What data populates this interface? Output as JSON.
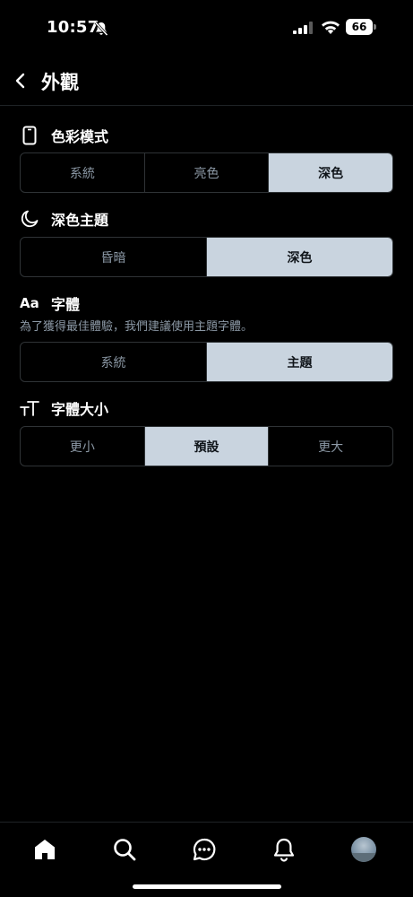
{
  "status_bar": {
    "time": "10:57",
    "battery": "66"
  },
  "header": {
    "title": "外觀"
  },
  "color_mode": {
    "title": "色彩模式",
    "options": [
      "系統",
      "亮色",
      "深色"
    ],
    "selected": "深色"
  },
  "dark_theme": {
    "title": "深色主題",
    "options": [
      "昏暗",
      "深色"
    ],
    "selected": "深色"
  },
  "font": {
    "icon_text": "Aa",
    "title": "字體",
    "description": "為了獲得最佳體驗，我們建議使用主題字體。",
    "options": [
      "系統",
      "主題"
    ],
    "selected": "主題"
  },
  "font_size": {
    "title": "字體大小",
    "options": [
      "更小",
      "預設",
      "更大"
    ],
    "selected": "預設"
  },
  "tab_bar": {
    "tabs": [
      "home-icon",
      "search-icon",
      "messages-icon",
      "notifications-icon",
      "profile-avatar"
    ]
  }
}
